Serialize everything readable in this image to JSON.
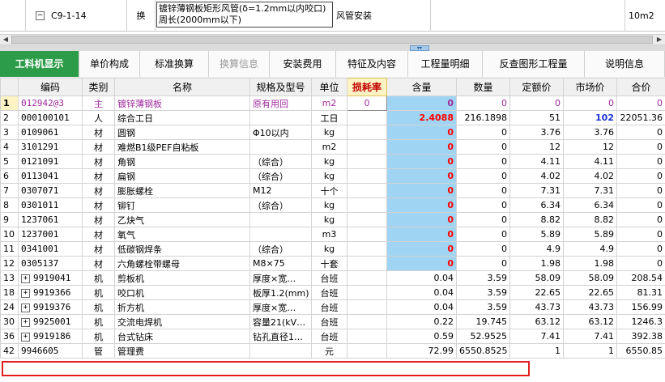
{
  "upper": {
    "code": "C9-1-14",
    "type": "换",
    "name_line1": "镀锌薄钢板矩形风管(δ=1.2mm以内咬口)",
    "name_line2": "周长(2000mm以下)",
    "spec": "风管安装",
    "unit": "10m2"
  },
  "tabs": [
    {
      "label": "工料机显示"
    },
    {
      "label": "单价构成"
    },
    {
      "label": "标准换算"
    },
    {
      "label": "换算信息"
    },
    {
      "label": "安装费用"
    },
    {
      "label": "特征及内容"
    },
    {
      "label": "工程量明细"
    },
    {
      "label": "反查图形工程量"
    },
    {
      "label": "说明信息"
    }
  ],
  "columns": [
    "编码",
    "类别",
    "名称",
    "规格及型号",
    "单位",
    "损耗率",
    "含量",
    "数量",
    "定额价",
    "市场价",
    "合价"
  ],
  "rows": [
    {
      "idx": "1",
      "code": "012942@3",
      "cat": "主",
      "name": "镀锌薄钢板",
      "spec": "原有用回",
      "unit": "m2",
      "loss": "0",
      "content": "0",
      "qty": "0",
      "price": "0",
      "market": "0",
      "total": "0"
    },
    {
      "idx": "2",
      "code": "000100101",
      "cat": "人",
      "name": "综合工日",
      "spec": "",
      "unit": "工日",
      "loss": "",
      "content": "2.4088",
      "qty": "216.1898",
      "price": "51",
      "market": "102",
      "total": "22051.36"
    },
    {
      "idx": "3",
      "code": "0109061",
      "cat": "材",
      "name": "圆钢",
      "spec": "Φ10以内",
      "unit": "kg",
      "loss": "",
      "content": "0",
      "qty": "0",
      "price": "3.76",
      "market": "3.76",
      "total": "0"
    },
    {
      "idx": "4",
      "code": "3101291",
      "cat": "材",
      "name": "难燃B1级PEF自粘板",
      "spec": "",
      "unit": "m2",
      "loss": "",
      "content": "0",
      "qty": "0",
      "price": "12",
      "market": "12",
      "total": "0"
    },
    {
      "idx": "5",
      "code": "0121091",
      "cat": "材",
      "name": "角钢",
      "spec": "（综合）",
      "unit": "kg",
      "loss": "",
      "content": "0",
      "qty": "0",
      "price": "4.11",
      "market": "4.11",
      "total": "0"
    },
    {
      "idx": "6",
      "code": "0113041",
      "cat": "材",
      "name": "扁钢",
      "spec": "（综合）",
      "unit": "kg",
      "loss": "",
      "content": "0",
      "qty": "0",
      "price": "4.02",
      "market": "4.02",
      "total": "0"
    },
    {
      "idx": "7",
      "code": "0307071",
      "cat": "材",
      "name": "膨胀螺栓",
      "spec": "M12",
      "unit": "十个",
      "loss": "",
      "content": "0",
      "qty": "0",
      "price": "7.31",
      "market": "7.31",
      "total": "0"
    },
    {
      "idx": "8",
      "code": "0301011",
      "cat": "材",
      "name": "铆钉",
      "spec": "（综合）",
      "unit": "kg",
      "loss": "",
      "content": "0",
      "qty": "0",
      "price": "6.34",
      "market": "6.34",
      "total": "0"
    },
    {
      "idx": "9",
      "code": "1237061",
      "cat": "材",
      "name": "乙炔气",
      "spec": "",
      "unit": "kg",
      "loss": "",
      "content": "0",
      "qty": "0",
      "price": "8.82",
      "market": "8.82",
      "total": "0"
    },
    {
      "idx": "10",
      "code": "1237001",
      "cat": "材",
      "name": "氧气",
      "spec": "",
      "unit": "m3",
      "loss": "",
      "content": "0",
      "qty": "0",
      "price": "5.89",
      "market": "5.89",
      "total": "0"
    },
    {
      "idx": "11",
      "code": "0341001",
      "cat": "材",
      "name": "低碳钢焊条",
      "spec": "（综合）",
      "unit": "kg",
      "loss": "",
      "content": "0",
      "qty": "0",
      "price": "4.9",
      "market": "4.9",
      "total": "0"
    },
    {
      "idx": "12",
      "code": "0305137",
      "cat": "材",
      "name": "六角螺栓带螺母",
      "spec": "M8×75",
      "unit": "十套",
      "loss": "",
      "content": "0",
      "qty": "0",
      "price": "1.98",
      "market": "1.98",
      "total": "0"
    },
    {
      "idx": "13",
      "code": "9919041",
      "cat": "机",
      "name": "剪板机",
      "spec": "厚度×宽…",
      "unit": "台班",
      "loss": "",
      "content": "0.04",
      "qty": "3.59",
      "price": "58.09",
      "market": "58.09",
      "total": "208.54",
      "plus": true
    },
    {
      "idx": "18",
      "code": "9919366",
      "cat": "机",
      "name": "咬口机",
      "spec": "板厚1.2(mm)",
      "unit": "台班",
      "loss": "",
      "content": "0.04",
      "qty": "3.59",
      "price": "22.65",
      "market": "22.65",
      "total": "81.31",
      "plus": true
    },
    {
      "idx": "24",
      "code": "9919376",
      "cat": "机",
      "name": "折方机",
      "spec": "厚度×宽…",
      "unit": "台班",
      "loss": "",
      "content": "0.04",
      "qty": "3.59",
      "price": "43.73",
      "market": "43.73",
      "total": "156.99",
      "plus": true
    },
    {
      "idx": "30",
      "code": "9925001",
      "cat": "机",
      "name": "交流电焊机",
      "spec": "容量21(kV…",
      "unit": "台班",
      "loss": "",
      "content": "0.22",
      "qty": "19.745",
      "price": "63.12",
      "market": "63.12",
      "total": "1246.3",
      "plus": true
    },
    {
      "idx": "36",
      "code": "9919186",
      "cat": "机",
      "name": "台式钻床",
      "spec": "钻孔直径1…",
      "unit": "台班",
      "loss": "",
      "content": "0.59",
      "qty": "52.9525",
      "price": "7.41",
      "market": "7.41",
      "total": "392.38",
      "plus": true
    },
    {
      "idx": "42",
      "code": "9946605",
      "cat": "管",
      "name": "管理费",
      "spec": "",
      "unit": "元",
      "loss": "",
      "content": "72.99",
      "qty": "6550.8525",
      "price": "1",
      "market": "1",
      "total": "6550.85"
    }
  ],
  "colors": {
    "accent_tab": "#2d9c48",
    "content_cell": "#9fd4f3",
    "highlight_box": "#e02020",
    "market_blue": "#1a33d6",
    "main_purple": "#9e2a9e"
  }
}
